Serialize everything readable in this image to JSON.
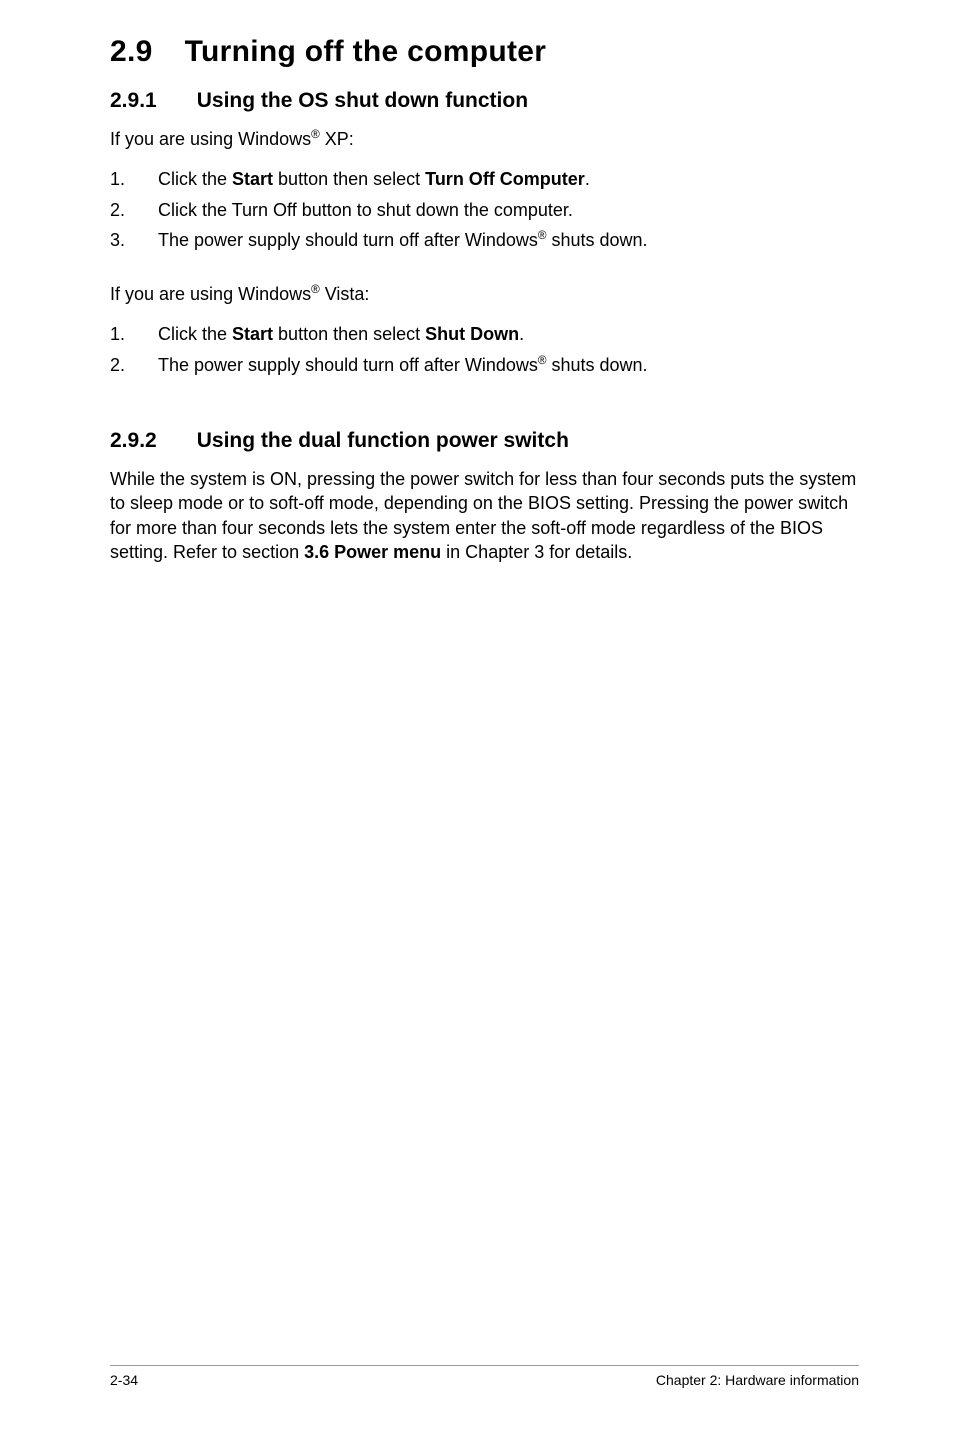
{
  "section": {
    "number": "2.9",
    "title": "Turning off the computer"
  },
  "sub1": {
    "number": "2.9.1",
    "title": "Using the OS shut down function",
    "intro_xp_a": "If you are using Windows",
    "intro_xp_b": " XP:",
    "xp_steps": [
      {
        "num": "1.",
        "pre": "Click the ",
        "b1": "Start",
        "mid": " button then select ",
        "b2": "Turn Off Computer",
        "post": "."
      },
      {
        "num": "2.",
        "text": "Click the Turn Off button to shut down the computer."
      },
      {
        "num": "3.",
        "pre": "The power supply should turn off after Windows",
        "sup": "®",
        "post": " shuts down."
      }
    ],
    "intro_vista_a": "If you are using Windows",
    "intro_vista_b": " Vista:",
    "vista_steps": [
      {
        "num": "1.",
        "pre": "Click the ",
        "b1": "Start",
        "mid": " button then select ",
        "b2": "Shut Down",
        "post": "."
      },
      {
        "num": "2.",
        "pre": "The power supply should turn off after Windows",
        "sup": "®",
        "post": " shuts down."
      }
    ]
  },
  "sub2": {
    "number": "2.9.2",
    "title": "Using the dual function power switch",
    "para_a": "While the system is ON, pressing the power switch for less than four seconds puts the system to sleep mode or to soft-off mode, depending on the BIOS setting. Pressing the power switch for more than four seconds lets the system enter the soft-off mode regardless of the BIOS setting. Refer to section ",
    "para_b": "3.6 Power menu",
    "para_c": " in Chapter 3 for details."
  },
  "footer": {
    "page": "2-34",
    "chapter": "Chapter 2: Hardware information"
  },
  "reg": "®"
}
